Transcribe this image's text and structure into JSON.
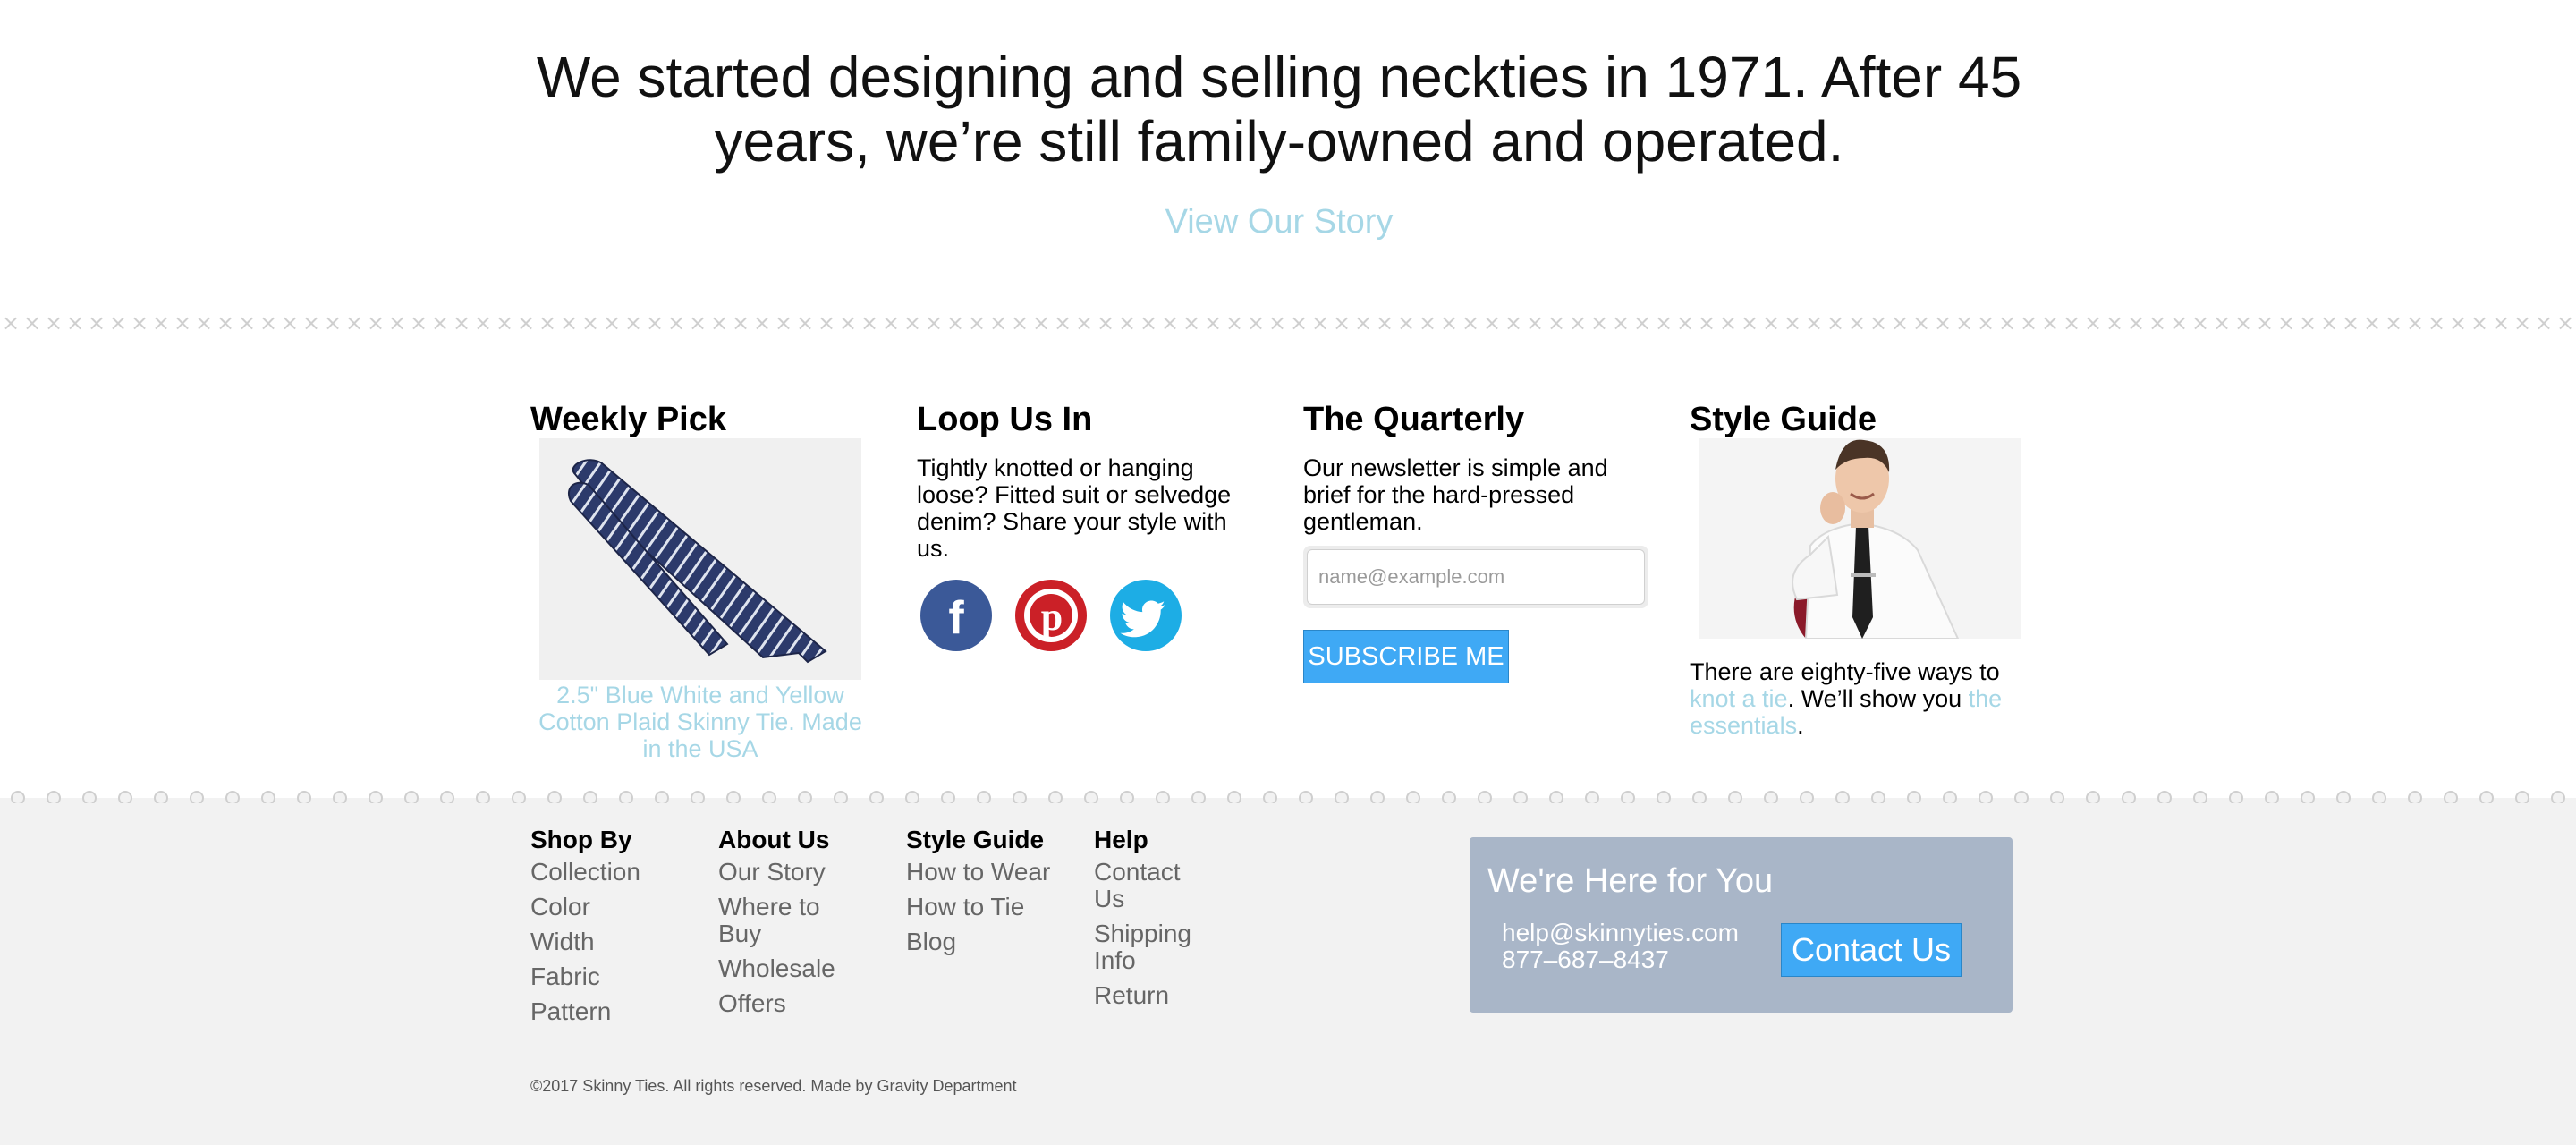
{
  "hero": {
    "statement": "We started designing and selling neckties in 1971. After 45 years, we’re still family-owned and operated.",
    "link_label": "View Our Story"
  },
  "weekly_pick": {
    "title": "Weekly Pick",
    "caption": "2.5\" Blue White and Yellow Cotton Plaid Skinny Tie. Made in the USA"
  },
  "loop": {
    "title": "Loop Us In",
    "body": "Tightly knotted or hanging loose? Fitted suit or selvedge denim? Share your style with us.",
    "socials": [
      "facebook-icon",
      "pinterest-icon",
      "twitter-icon"
    ]
  },
  "quarterly": {
    "title": "The Quarterly",
    "body": "Our newsletter is simple and brief for the hard-pressed gentleman.",
    "email_placeholder": "name@example.com",
    "email_value": "",
    "subscribe_label": "SUBSCRIBE ME"
  },
  "style_guide": {
    "title": "Style Guide",
    "text_before": "There are eighty-five ways to ",
    "link1": "knot a tie",
    "text_middle": ". We’ll show you ",
    "link2": "the essentials",
    "text_after": "."
  },
  "footer": {
    "columns": [
      {
        "title": "Shop By",
        "links": [
          "Collection",
          "Color",
          "Width",
          "Fabric",
          "Pattern"
        ]
      },
      {
        "title": "About Us",
        "links": [
          "Our Story",
          "Where to Buy",
          "Wholesale",
          "Offers"
        ]
      },
      {
        "title": "Style Guide",
        "links": [
          "How to Wear",
          "How to Tie",
          "Blog"
        ]
      },
      {
        "title": "Help",
        "links": [
          "Contact Us",
          "Shipping Info",
          "Return"
        ]
      }
    ],
    "help_box": {
      "title": "We're Here for You",
      "email": "help@skinnyties.com",
      "phone": "877–687–8437",
      "contact_label": "Contact Us"
    },
    "copyright": "©2017 Skinny Ties. All rights reserved. Made by Gravity Department"
  },
  "colors": {
    "accent_link": "#a6d7e6",
    "button_blue": "#3fa9f5",
    "help_box_bg": "#a9b6c8",
    "footer_bg": "#f2f2f2",
    "facebook": "#3b5998",
    "pinterest": "#cb2027",
    "twitter": "#1dade5"
  }
}
